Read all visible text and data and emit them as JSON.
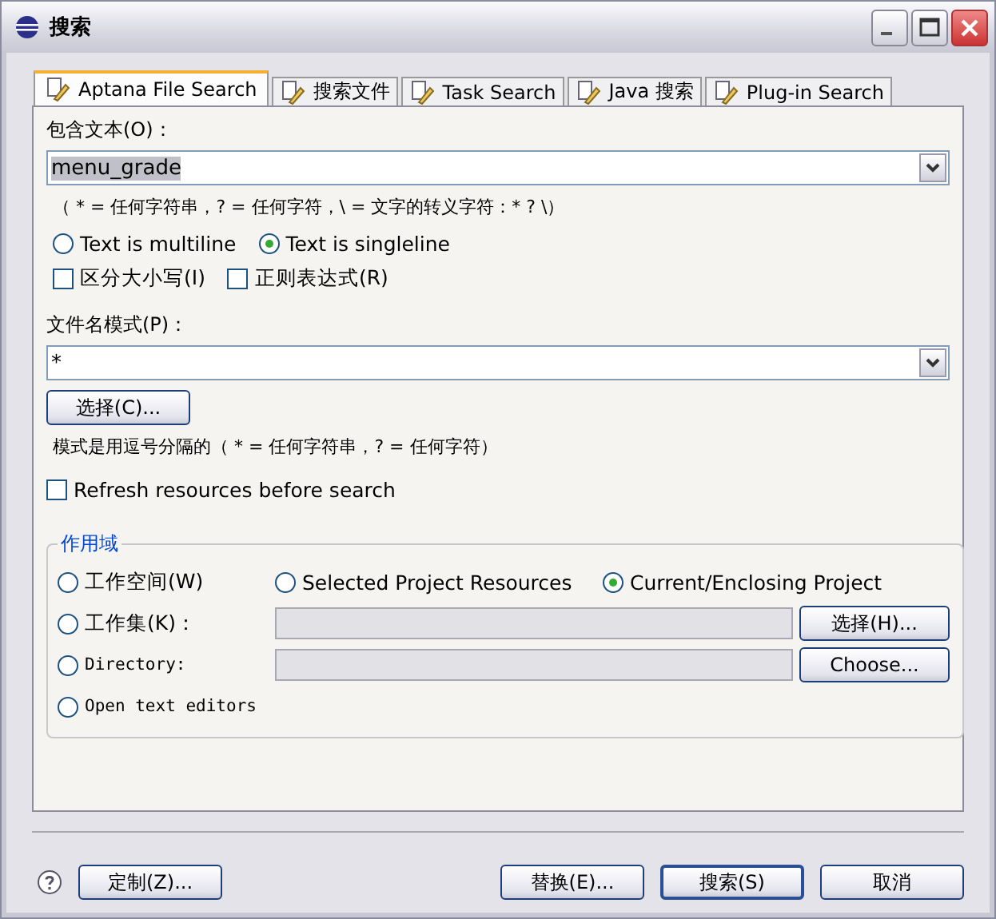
{
  "window": {
    "title": "搜索"
  },
  "tabs": [
    {
      "label": "Aptana File Search",
      "selected": true
    },
    {
      "label": "搜索文件",
      "selected": false
    },
    {
      "label": "Task Search",
      "selected": false
    },
    {
      "label": "Java 搜索",
      "selected": false
    },
    {
      "label": "Plug-in Search",
      "selected": false
    }
  ],
  "containing_text": {
    "label": "包含文本(O)：",
    "value": "menu_grade",
    "hint": "（ * = 任何字符串，? = 任何字符，\\ = 文字的转义字符：* ? \\）"
  },
  "text_mode": [
    {
      "label": "Text is multiline",
      "selected": false
    },
    {
      "label": "Text is singleline",
      "selected": true
    }
  ],
  "options": [
    {
      "label": "区分大小写(I)",
      "checked": false
    },
    {
      "label": "正则表达式(R)",
      "checked": false
    }
  ],
  "file_pattern": {
    "label": "文件名模式(P)：",
    "value": "*",
    "button": "选择(C)...",
    "hint": "模式是用逗号分隔的（ * = 任何字符串，? = 任何字符）"
  },
  "refresh": {
    "label": "Refresh resources before search",
    "checked": false
  },
  "scope": {
    "title": "作用域",
    "options": [
      {
        "label": "工作空间(W)",
        "selected": false
      },
      {
        "label": "Selected Project Resources",
        "selected": false
      },
      {
        "label": "Current/Enclosing Project",
        "selected": true
      },
      {
        "label": "工作集(K)：",
        "selected": false,
        "button": "选择(H)..."
      },
      {
        "label": "Directory:",
        "selected": false,
        "button": "Choose..."
      },
      {
        "label": "Open text editors",
        "selected": false
      }
    ]
  },
  "footer": {
    "left_button": "定制(Z)...",
    "buttons": [
      {
        "label": "替换(E)...",
        "default": false
      },
      {
        "label": "搜索(S)",
        "default": true
      },
      {
        "label": "取消",
        "default": false
      }
    ]
  }
}
